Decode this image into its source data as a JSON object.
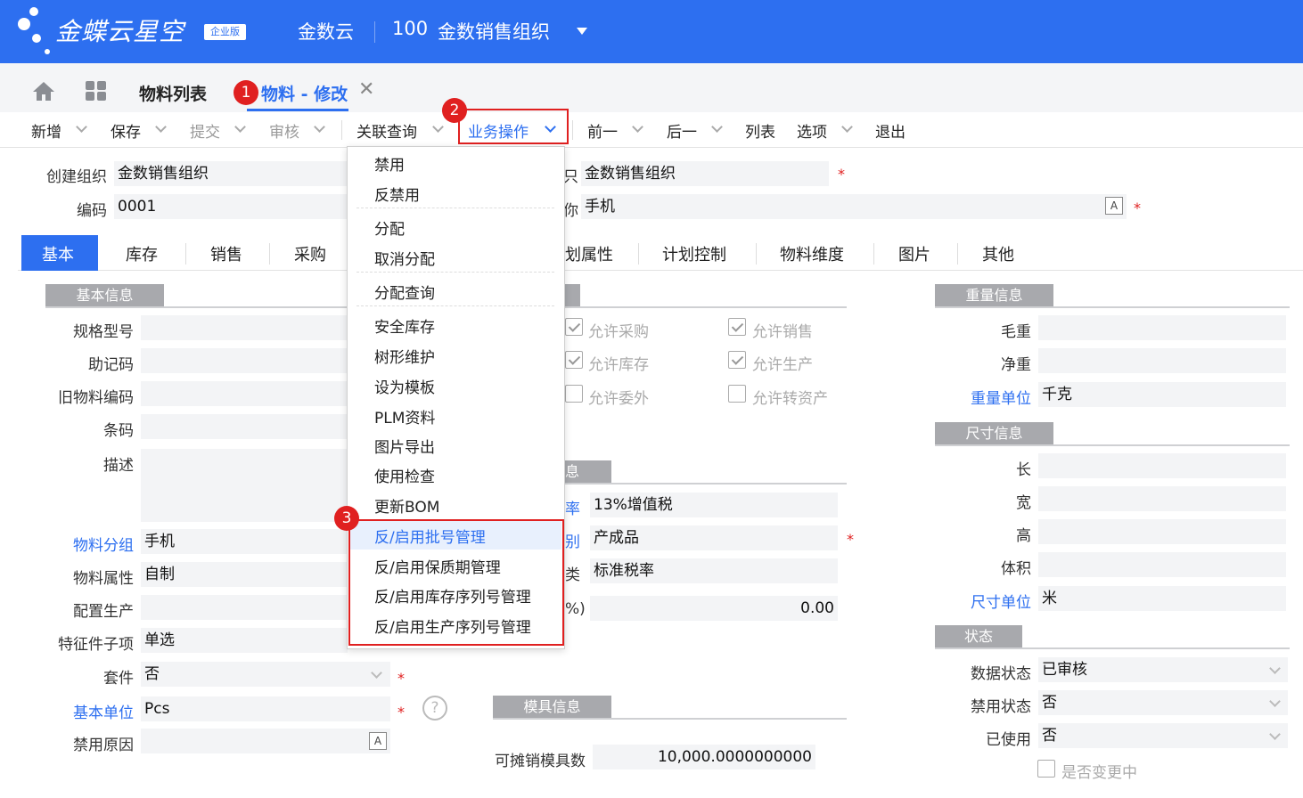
{
  "header": {
    "brand": "金蝶云星空",
    "edition": "企业版",
    "company": "金数云",
    "org_code": "100",
    "org_name": "金数销售组织"
  },
  "tabs": {
    "list": "物料列表",
    "edit": "物料 - 修改"
  },
  "toolbar": {
    "new": "新增",
    "save": "保存",
    "submit": "提交",
    "audit": "审核",
    "related": "关联查询",
    "biz": "业务操作",
    "prev": "前一",
    "next": "后一",
    "list": "列表",
    "options": "选项",
    "exit": "退出"
  },
  "head_fields": {
    "create_org_label": "创建组织",
    "create_org": "金数销售组织",
    "code_label": "编码",
    "code": "0001",
    "use_org_tail": "只",
    "use_org": "金数销售组织",
    "name_tail": "你",
    "name": "手机"
  },
  "form_tabs": [
    "基本",
    "库存",
    "销售",
    "采购",
    "划属性",
    "计划控制",
    "物料维度",
    "图片",
    "其他"
  ],
  "basic": {
    "section": "基本信息",
    "spec": "规格型号",
    "mnemonic": "助记码",
    "old_code": "旧物料编码",
    "barcode": "条码",
    "desc": "描述",
    "group_label": "物料分组",
    "group": "手机",
    "prop_label": "物料属性",
    "prop": "自制",
    "config_label": "配置生产",
    "feature_label": "特征件子项",
    "feature": "单选",
    "kit_label": "套件",
    "kit": "否",
    "unit_label": "基本单位",
    "unit": "Pcs",
    "disable_reason": "禁用原因"
  },
  "control": {
    "allow_purchase": "允许采购",
    "allow_sale": "允许销售",
    "allow_stock": "允许库存",
    "allow_produce": "允许生产",
    "allow_outsource": "允许委外",
    "allow_asset": "允许转资产"
  },
  "finance": {
    "section_tail": "息",
    "tax_label_tail": "率",
    "tax": "13%增值税",
    "cat_label_tail": "别",
    "cat": "产成品",
    "taxcat_label_tail": "类",
    "taxcat": "标准税率",
    "pct_label_tail": "%)",
    "pct": "0.00"
  },
  "mold": {
    "section": "模具信息",
    "count_label": "可摊销模具数",
    "count": "10,000.0000000000"
  },
  "weight": {
    "section": "重量信息",
    "gross": "毛重",
    "net": "净重",
    "unit_label": "重量单位",
    "unit": "千克"
  },
  "size": {
    "section": "尺寸信息",
    "len": "长",
    "wid": "宽",
    "hei": "高",
    "vol": "体积",
    "unit_label": "尺寸单位",
    "unit": "米"
  },
  "status": {
    "section": "状态",
    "data_label": "数据状态",
    "data": "已审核",
    "disable_label": "禁用状态",
    "disable": "否",
    "used_label": "已使用",
    "used": "否",
    "changing": "是否变更中"
  },
  "menu": [
    "禁用",
    "反禁用",
    "分配",
    "取消分配",
    "分配查询",
    "安全库存",
    "树形维护",
    "设为模板",
    "PLM资料",
    "图片导出",
    "使用检查",
    "更新BOM",
    "反/启用批号管理",
    "反/启用保质期管理",
    "反/启用库存序列号管理",
    "反/启用生产序列号管理"
  ],
  "badges": [
    "1",
    "2",
    "3"
  ],
  "colors": {
    "brand": "#2d6ff0",
    "highlight": "#e02020"
  }
}
